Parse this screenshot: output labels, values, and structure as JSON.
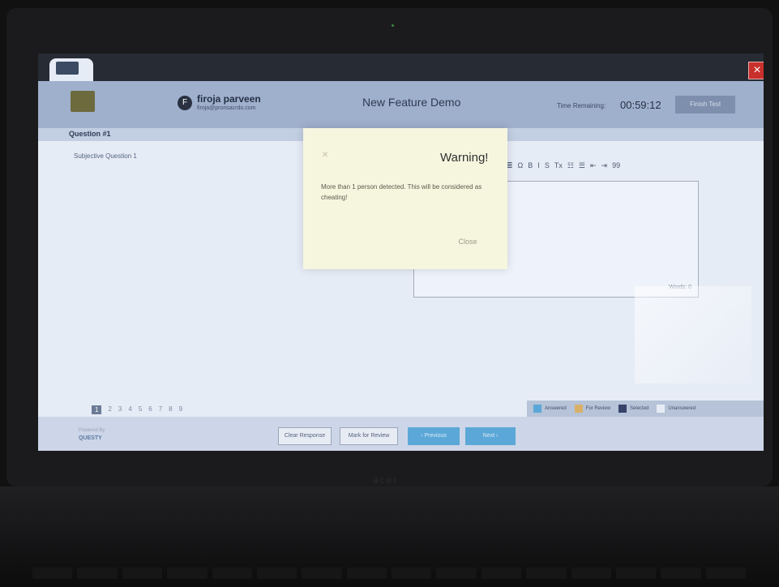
{
  "header": {
    "user_initial": "F",
    "user_name": "firoja parveen",
    "user_email": "firoja@pronsacrdo.com",
    "page_title": "New Feature Demo",
    "time_label": "Time Remaining:",
    "time_value": "00:59:12",
    "finish_label": "Finish Test"
  },
  "question": {
    "number_label": "Question #1",
    "subject_label": "Subjective Question 1"
  },
  "editor": {
    "toolbar": [
      "≣",
      "Ω",
      "B",
      "I",
      "S",
      "Tx",
      "☷",
      "☰",
      "⇤",
      "⇥",
      "99"
    ],
    "word_count": "Words: 0"
  },
  "navigation": {
    "question_numbers": [
      "1",
      "2",
      "3",
      "4",
      "5",
      "6",
      "7",
      "8",
      "9"
    ],
    "legend": [
      {
        "label": "Answered",
        "color": "#5ba8d8"
      },
      {
        "label": "For Review",
        "color": "#d8b067"
      },
      {
        "label": "Selected",
        "color": "#38436a"
      },
      {
        "label": "Unanswered",
        "color": "#e7ecf4"
      }
    ]
  },
  "footer": {
    "powered_label": "Powered By",
    "brand_name": "QUESTY",
    "clear_label": "Clear Response",
    "review_label": "Mark for Review",
    "previous_label": "‹ Previous",
    "next_label": "Next ›"
  },
  "modal": {
    "close_icon": "×",
    "title": "Warning!",
    "message": "More than 1 person detected. This will be considered as cheating!",
    "button_label": "Close"
  },
  "window": {
    "close_icon": "×"
  }
}
